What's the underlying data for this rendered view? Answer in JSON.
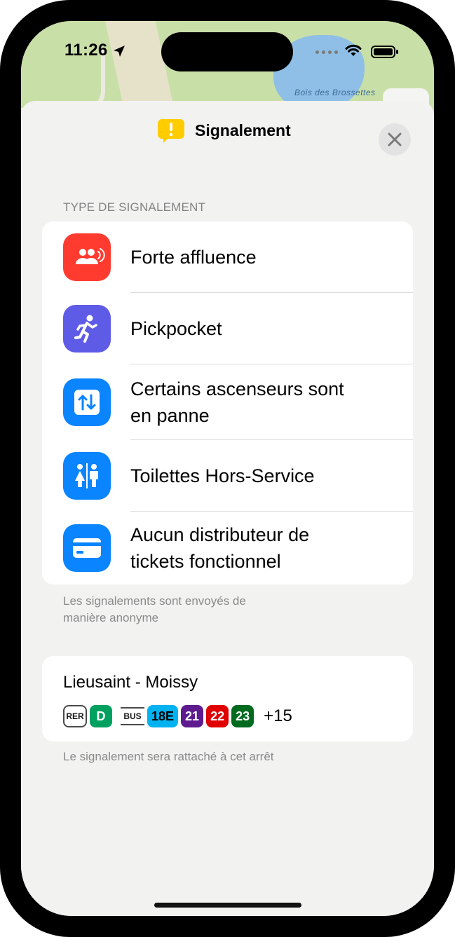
{
  "status_bar": {
    "time": "11:26"
  },
  "map": {
    "place_label": "Bois des Brossettes"
  },
  "header": {
    "title": "Signalement"
  },
  "section": {
    "label": "TYPE DE SIGNALEMENT"
  },
  "reports": [
    {
      "label": "Forte affluence",
      "icon": "crowd-icon",
      "color": "#ff3b30"
    },
    {
      "label": "Pickpocket",
      "icon": "running-person-icon",
      "color": "#5e5ce6"
    },
    {
      "label_line1": "Certains ascenseurs sont",
      "label_line2": "en panne",
      "icon": "elevator-icon",
      "color": "#0a84ff"
    },
    {
      "label": "Toilettes Hors-Service",
      "icon": "restroom-icon",
      "color": "#0a84ff"
    },
    {
      "label_line1": "Aucun distributeur de",
      "label_line2": "tickets fonctionnel",
      "icon": "ticket-card-icon",
      "color": "#0a84ff"
    }
  ],
  "footnote": {
    "line1": "Les signalements sont envoyés de",
    "line2": "manière anonyme"
  },
  "stop": {
    "name": "Lieusaint - Moissy",
    "rer_label": "RER",
    "rer_line": {
      "label": "D",
      "color": "#00a060"
    },
    "bus_label": "BUS",
    "bus_lines": [
      {
        "label": "18E",
        "color": "#00b2f0",
        "text_color": "#000000"
      },
      {
        "label": "21",
        "color": "#5e1b8f",
        "text_color": "#ffffff"
      },
      {
        "label": "22",
        "color": "#e00000",
        "text_color": "#ffffff"
      },
      {
        "label": "23",
        "color": "#006b1f",
        "text_color": "#ffffff"
      }
    ],
    "more": "+15"
  },
  "stop_note": "Le signalement sera rattaché à cet arrêt"
}
